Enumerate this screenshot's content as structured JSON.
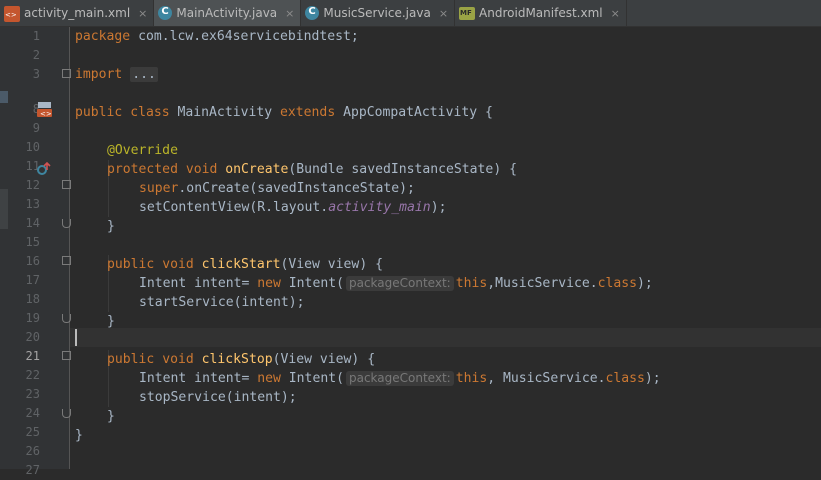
{
  "tabs": [
    {
      "label": "activity_main.xml",
      "icon": "xml-file-icon",
      "active": false
    },
    {
      "label": "MainActivity.java",
      "icon": "java-class-icon",
      "active": true
    },
    {
      "label": "MusicService.java",
      "icon": "java-class-icon",
      "active": false
    },
    {
      "label": "AndroidManifest.xml",
      "icon": "manifest-file-icon",
      "active": false
    }
  ],
  "tab_close": "×",
  "line_numbers": [
    "1",
    "2",
    "3",
    "8",
    "9",
    "10",
    "11",
    "12",
    "13",
    "14",
    "15",
    "16",
    "17",
    "18",
    "19",
    "20",
    "21",
    "22",
    "23",
    "24",
    "25",
    "26",
    "27"
  ],
  "current_line": "21",
  "code": {
    "l1": {
      "kw": "package",
      "rest": " com.lcw.ex64servicebindtest;"
    },
    "l3": {
      "kw": "import",
      "folded": "..."
    },
    "l9": {
      "kw1": "public",
      "kw2": "class",
      "name": "MainActivity",
      "kw3": "extends",
      "rest": " AppCompatActivity {"
    },
    "l11": {
      "ann": "@Override"
    },
    "l12": {
      "kw1": "protected",
      "kw2": "void",
      "fn": "onCreate",
      "rest": "(Bundle savedInstanceState) {"
    },
    "l13": {
      "kw": "super",
      "rest": ".onCreate(savedInstanceState);"
    },
    "l14": {
      "pre": "setContentView(R.layout.",
      "field": "activity_main",
      "post": ");"
    },
    "l15": {
      "text": "}"
    },
    "l17": {
      "kw1": "public",
      "kw2": "void",
      "fn": "clickStart",
      "rest": "(View view) {"
    },
    "l18": {
      "pre": "Intent intent= ",
      "kw": "new",
      "mid": " Intent(",
      "hint": "packageContext:",
      "kw2": "this",
      "post": ",MusicService.",
      "kw3": "class",
      "end": ");"
    },
    "l19": {
      "text": "startService(intent);"
    },
    "l20": {
      "text": "}"
    },
    "l22": {
      "kw1": "public",
      "kw2": "void",
      "fn": "clickStop",
      "rest": "(View view) {"
    },
    "l23": {
      "pre": "Intent intent= ",
      "kw": "new",
      "mid": " Intent(",
      "hint": "packageContext:",
      "kw2": "this",
      "post": ", MusicService.",
      "kw3": "class",
      "end": ");"
    },
    "l24": {
      "text": "stopService(intent);"
    },
    "l25": {
      "text": "}"
    },
    "l26": {
      "text": "}"
    }
  },
  "colors": {
    "background": "#2b2b2b",
    "keyword": "#cc7832",
    "annotation": "#bbb529",
    "method": "#ffc66d",
    "field": "#9876aa",
    "text": "#a9b7c6"
  }
}
